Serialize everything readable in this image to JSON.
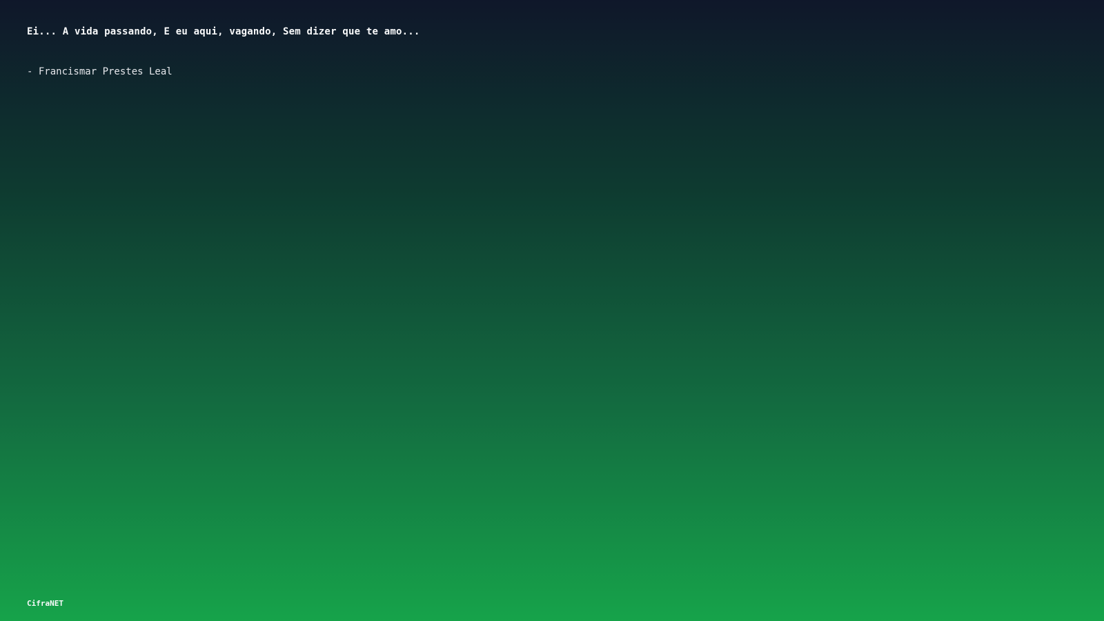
{
  "quote": {
    "text": "Ei... A vida passando, E eu aqui, vagando, Sem dizer que te amo...",
    "author": "- Francismar Prestes Leal"
  },
  "footer": {
    "brand": "CifraNET"
  },
  "colors": {
    "gradient_top": "#0f172a",
    "gradient_bottom": "#16a34a",
    "text": "#f9fafb"
  }
}
